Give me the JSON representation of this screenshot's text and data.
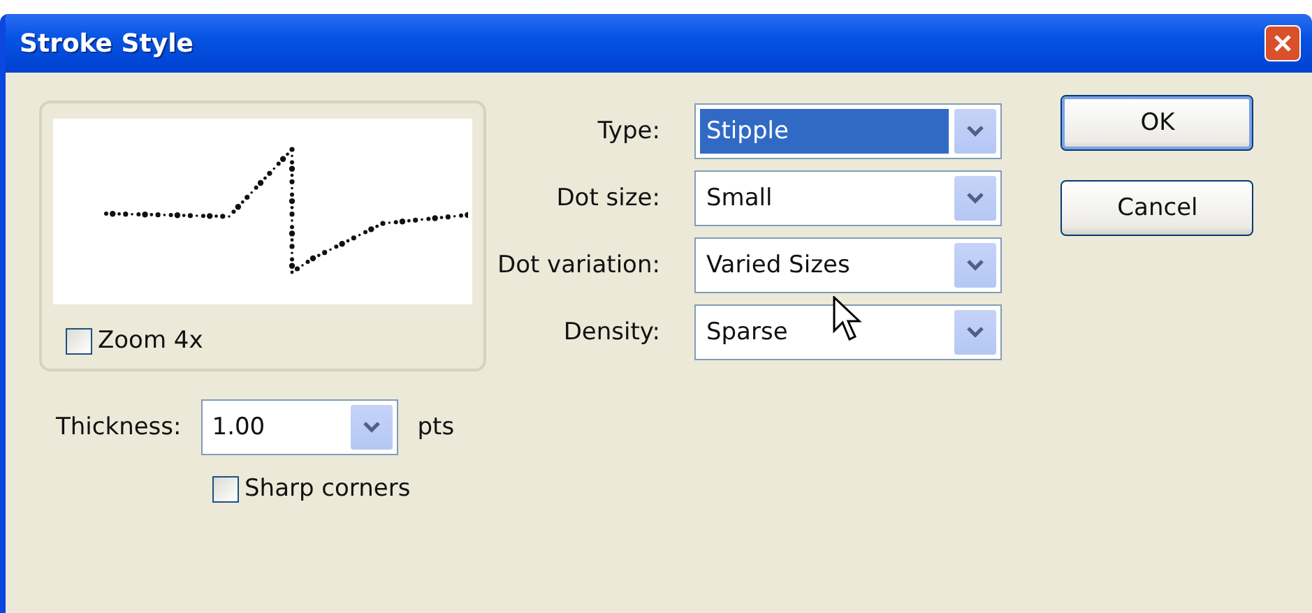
{
  "window": {
    "title": "Stroke Style"
  },
  "preview": {
    "zoom": {
      "label": "Zoom 4x",
      "checked": false
    }
  },
  "thickness": {
    "label": "Thickness:",
    "value": "1.00",
    "unit": "pts"
  },
  "sharp_corners": {
    "label": "Sharp corners",
    "checked": false
  },
  "fields": [
    {
      "label": "Type:",
      "value": "Stipple",
      "highlighted": true
    },
    {
      "label": "Dot size:",
      "value": "Small",
      "highlighted": false
    },
    {
      "label": "Dot variation:",
      "value": "Varied Sizes",
      "highlighted": false
    },
    {
      "label": "Density:",
      "value": "Sparse",
      "highlighted": false
    }
  ],
  "buttons": [
    {
      "label": "OK",
      "default": true
    },
    {
      "label": "Cancel",
      "default": false
    }
  ]
}
